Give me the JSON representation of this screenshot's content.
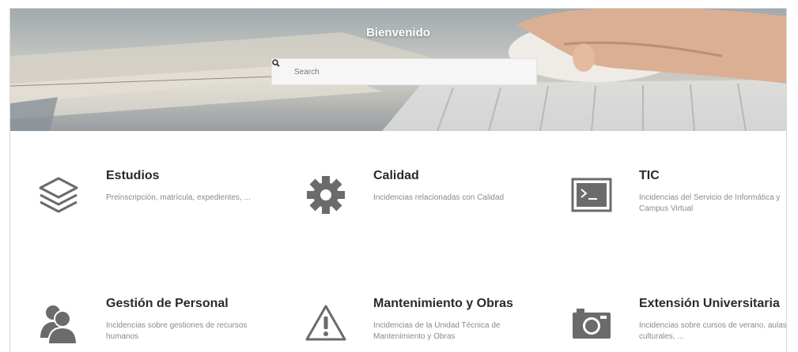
{
  "header": {
    "title": "Bienvenido",
    "search_placeholder": "Search"
  },
  "categories": [
    {
      "name": "estudios",
      "title": "Estudios",
      "description": "Preinscripción, matrícula, expedientes, ...",
      "icon": "layers-icon"
    },
    {
      "name": "calidad",
      "title": "Calidad",
      "description": "Incidencias relacionadas con Calidad",
      "icon": "gear-icon"
    },
    {
      "name": "tic",
      "title": "TIC",
      "description": "Incidencias del Servicio de Informática y Campus Virtual",
      "icon": "terminal-icon"
    },
    {
      "name": "gestion-personal",
      "title": "Gestión de Personal",
      "description": "Incidencias sobre gestiones de recursos humanos",
      "icon": "users-icon"
    },
    {
      "name": "mantenimiento",
      "title": "Mantenimiento y Obras",
      "description": "Incidencias de la Unidad Técnica de Mantenimiento y Obras",
      "icon": "warning-icon"
    },
    {
      "name": "extension",
      "title": "Extensión Universitaria",
      "description": "Incidencias sobre cursos de verano, aulas culturales, ...",
      "icon": "camera-icon"
    }
  ],
  "colors": {
    "icon": "#6b6b6b",
    "title": "#2a2a2a",
    "description": "#8a8a8a"
  }
}
